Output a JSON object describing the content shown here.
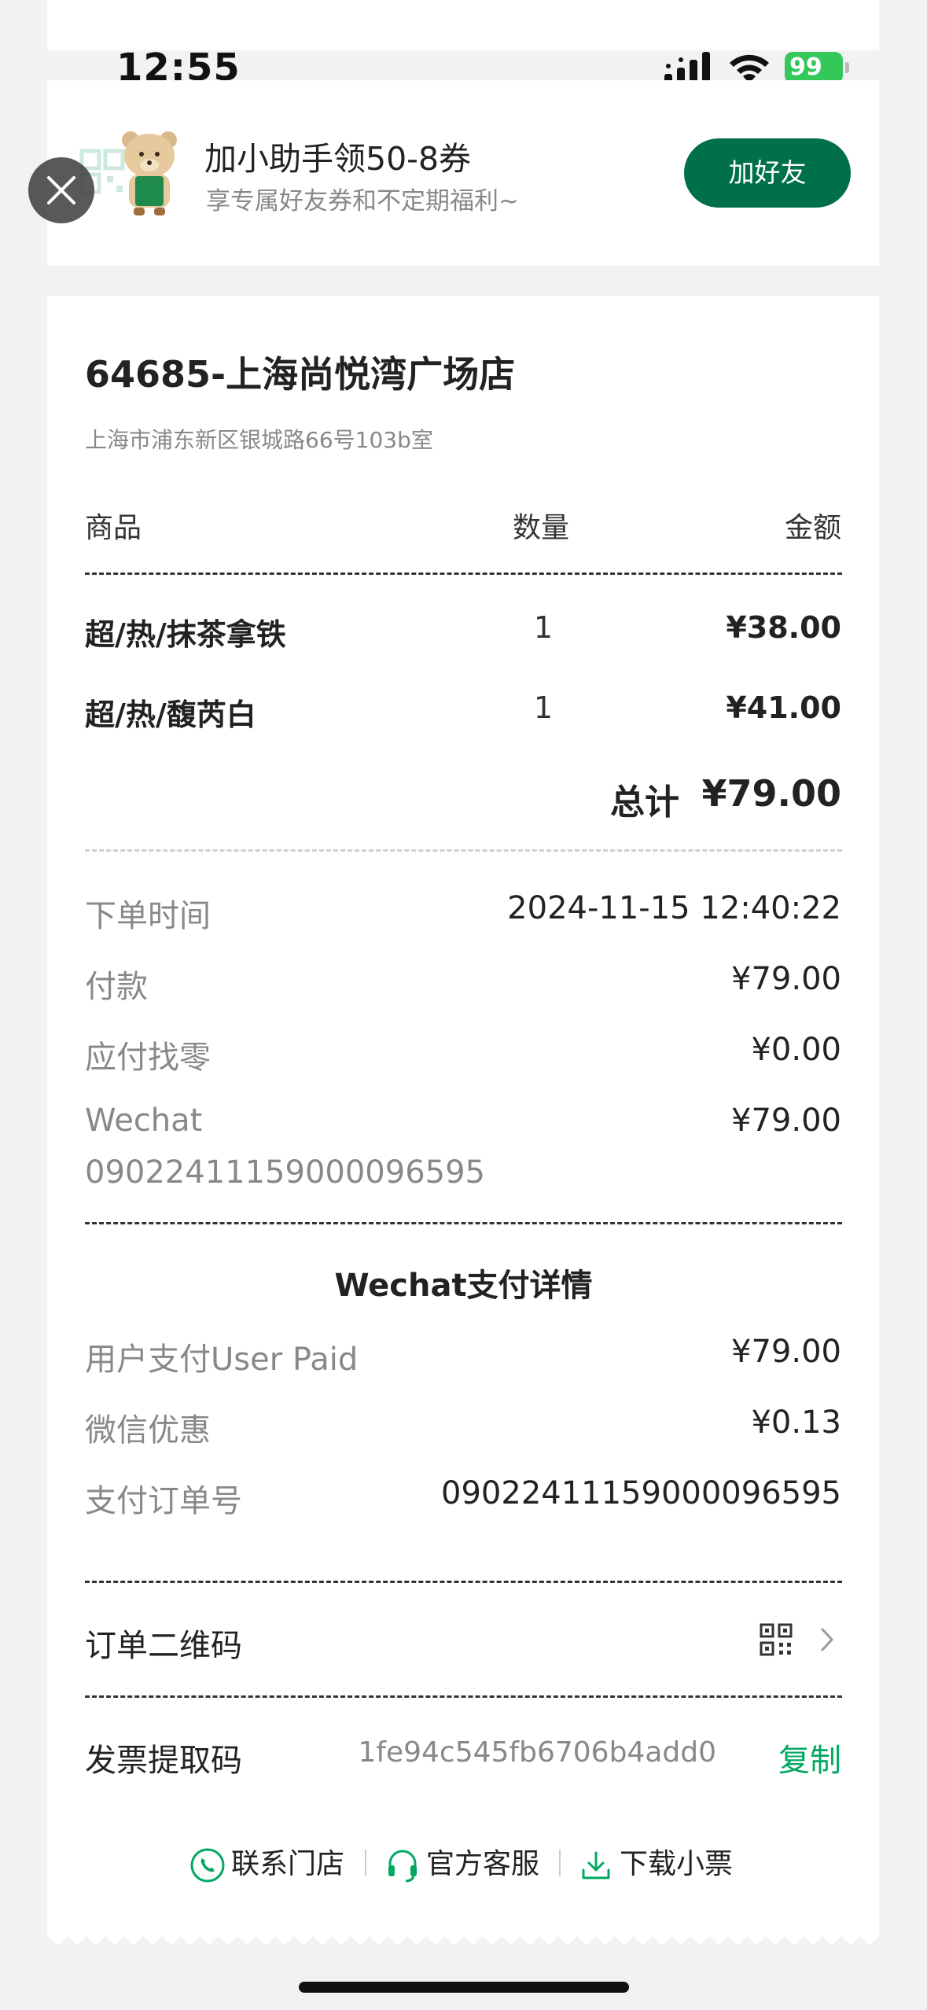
{
  "status_bar": {
    "time": "12:55",
    "battery": "99"
  },
  "banner": {
    "title": "加小助手领50-8券",
    "subtitle": "享专属好友券和不定期福利~",
    "button": "加好友"
  },
  "store": {
    "name": "64685-上海尚悦湾广场店",
    "address": "上海市浦东新区银城路66号103b室"
  },
  "table": {
    "headers": {
      "item": "商品",
      "qty": "数量",
      "amount": "金额"
    },
    "items": [
      {
        "name": "超/热/抹茶拿铁",
        "qty": "1",
        "price": "¥38.00"
      },
      {
        "name": "超/热/馥芮白",
        "qty": "1",
        "price": "¥41.00"
      }
    ],
    "total_label": "总计",
    "total_value": "¥79.00"
  },
  "order": {
    "time_label": "下单时间",
    "time_value": "2024-11-15 12:40:22",
    "pay_label": "付款",
    "pay_value": "¥79.00",
    "change_label": "应付找零",
    "change_value": "¥0.00",
    "method_label": "Wechat",
    "method_value": "¥79.00",
    "method_id": "09022411159000096595"
  },
  "wechat": {
    "title": "Wechat支付详情",
    "user_paid_label": "用户支付User Paid",
    "user_paid_value": "¥79.00",
    "discount_label": "微信优惠",
    "discount_value": "¥0.13",
    "order_no_label": "支付订单号",
    "order_no_value": "09022411159000096595"
  },
  "qr_row": {
    "label": "订单二维码"
  },
  "invoice": {
    "label": "发票提取码",
    "code": "1fe94c545fb6706b4add0",
    "copy": "复制"
  },
  "footer": {
    "contact_store": "联系门店",
    "customer_service": "官方客服",
    "download_receipt": "下载小票"
  },
  "colors": {
    "brand_green": "#00704a",
    "link_green": "#00a862"
  }
}
